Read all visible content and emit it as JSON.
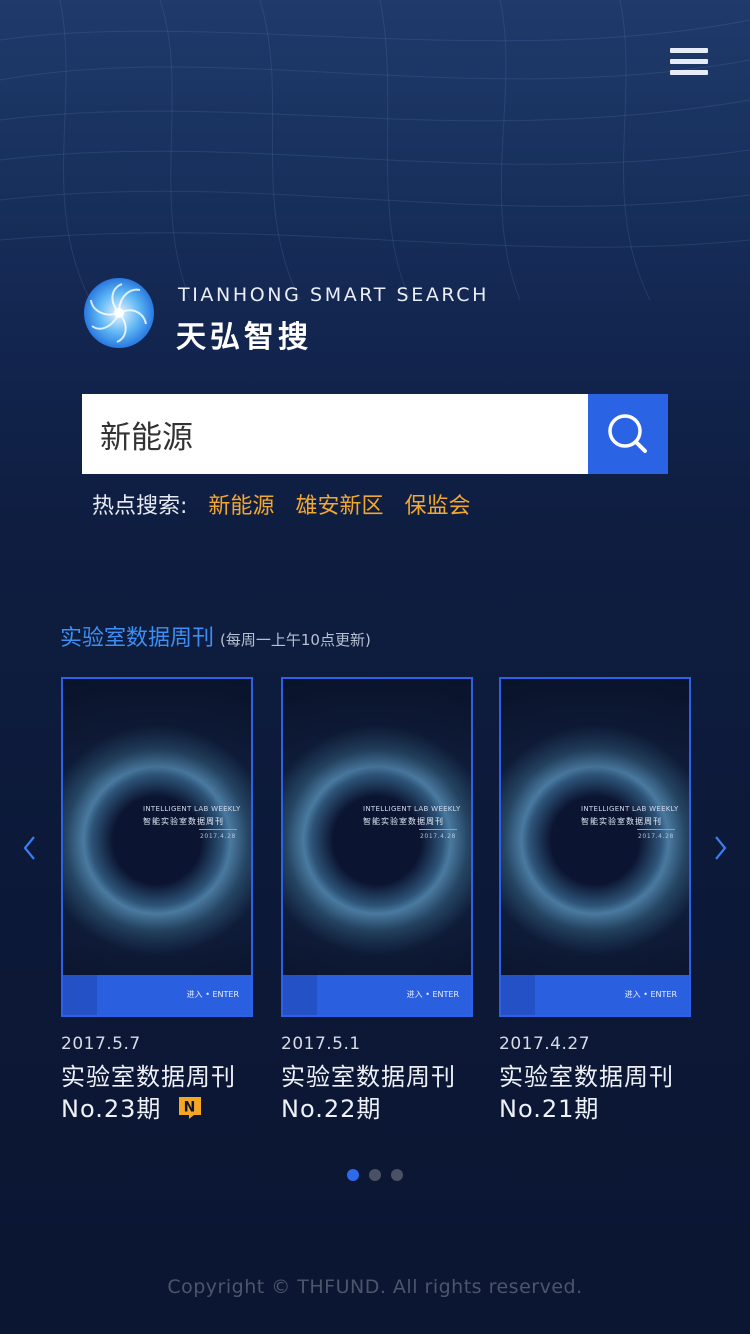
{
  "header": {
    "menu_icon": "hamburger-menu-icon"
  },
  "brand": {
    "en": "TIANHONG SMART SEARCH",
    "cn": "天弘智搜",
    "logo_icon": "tianhong-flower-logo"
  },
  "search": {
    "value": "新能源",
    "button_icon": "search-icon"
  },
  "hot": {
    "label": "热点搜索:",
    "keywords": [
      "新能源",
      "雄安新区",
      "保监会"
    ]
  },
  "weekly": {
    "title": "实验室数据周刊",
    "subtitle": "(每周一上午10点更新)",
    "cover": {
      "en": "INTELLIGENT LAB WEEKLY",
      "cn": "智能实验室数据周刊",
      "date": "2017.4.28",
      "enter": "进入 • ENTER"
    },
    "items": [
      {
        "date": "2017.5.7",
        "name": "实验室数据周刊",
        "no": "No.23期",
        "badge": "N"
      },
      {
        "date": "2017.5.1",
        "name": "实验室数据周刊",
        "no": "No.22期"
      },
      {
        "date": "2017.4.27",
        "name": "实验室数据周刊",
        "no": "No.21期"
      }
    ]
  },
  "pager": {
    "count": 3,
    "active": 1
  },
  "footer": {
    "copyright": "Copyright © THFUND. All rights reserved."
  },
  "colors": {
    "accent": "#2a63e4",
    "hot_keyword": "#f2a72e",
    "section_title": "#3d8ff5",
    "badge": "#f5a623"
  }
}
